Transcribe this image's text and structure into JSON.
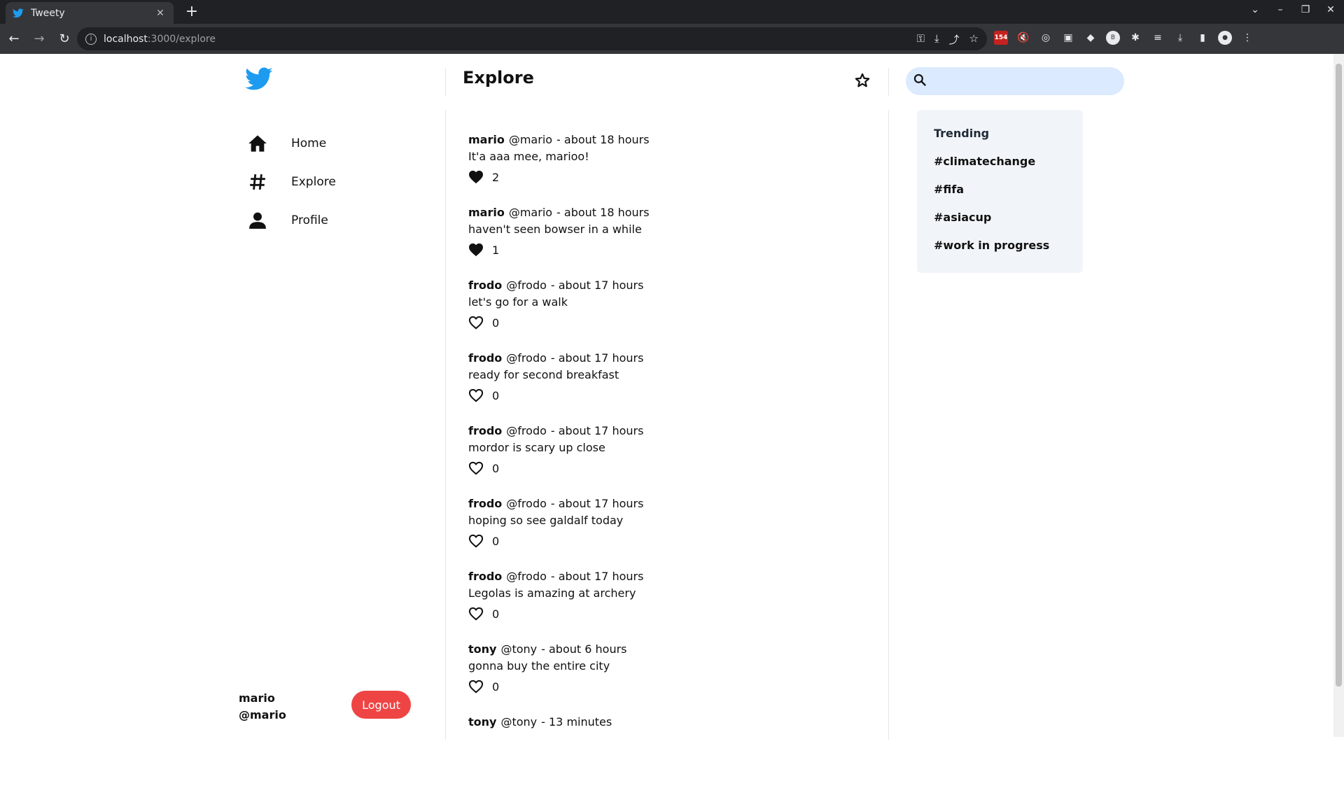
{
  "browser": {
    "tab_title": "Tweety",
    "tab_close": "✕",
    "new_tab": "+",
    "url_host": "localhost",
    "url_path": ":3000/explore",
    "ext_badge": "154",
    "profile_initial": "B"
  },
  "app": {
    "page_title": "Explore",
    "nav": [
      {
        "label": "Home",
        "icon": "home-icon"
      },
      {
        "label": "Explore",
        "icon": "hashtag-icon"
      },
      {
        "label": "Profile",
        "icon": "user-icon"
      }
    ],
    "current_user": {
      "name": "mario",
      "handle": "@mario"
    },
    "logout_label": "Logout",
    "search": {
      "placeholder": ""
    },
    "trending": {
      "title": "Trending",
      "tags": [
        "#climatechange",
        "#fifa",
        "#asiacup",
        "#work in progress"
      ]
    },
    "colors": {
      "accent": "#1d9bf0",
      "logout": "#ef4444",
      "search_bg": "#dbeafe",
      "trending_bg": "#f1f5f9"
    }
  },
  "tweets": [
    {
      "name": "mario",
      "handle": "@mario",
      "time": "- about 18 hours",
      "text": "It'a aaa mee, marioo!",
      "likes": "2",
      "liked": true
    },
    {
      "name": "mario",
      "handle": "@mario",
      "time": "- about 18 hours",
      "text": "haven't seen bowser in a while",
      "likes": "1",
      "liked": true
    },
    {
      "name": "frodo",
      "handle": "@frodo",
      "time": "- about 17 hours",
      "text": "let's go for a walk",
      "likes": "0",
      "liked": false
    },
    {
      "name": "frodo",
      "handle": "@frodo",
      "time": "- about 17 hours",
      "text": "ready for second breakfast",
      "likes": "0",
      "liked": false
    },
    {
      "name": "frodo",
      "handle": "@frodo",
      "time": "- about 17 hours",
      "text": "mordor is scary up close",
      "likes": "0",
      "liked": false
    },
    {
      "name": "frodo",
      "handle": "@frodo",
      "time": "- about 17 hours",
      "text": "hoping so see galdalf today",
      "likes": "0",
      "liked": false
    },
    {
      "name": "frodo",
      "handle": "@frodo",
      "time": "- about 17 hours",
      "text": "Legolas is amazing at archery",
      "likes": "0",
      "liked": false
    },
    {
      "name": "tony",
      "handle": "@tony",
      "time": "- about 6 hours",
      "text": "gonna buy the entire city",
      "likes": "0",
      "liked": false
    },
    {
      "name": "tony",
      "handle": "@tony",
      "time": "- 13 minutes",
      "text": "",
      "likes": "",
      "liked": false
    }
  ]
}
